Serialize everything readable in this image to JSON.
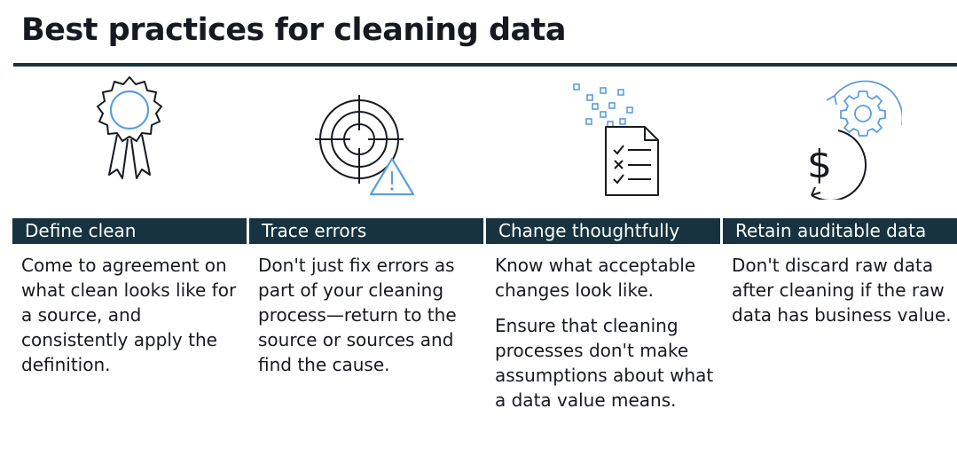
{
  "title": "Best practices for cleaning data",
  "colors": {
    "band": "#16333f",
    "accent": "#5b9ee0",
    "ink": "#16191f"
  },
  "practices": [
    {
      "heading": "Define clean",
      "icon": "award-ribbon-icon",
      "paragraphs": [
        "Come to agreement on what clean looks like for a source, and consistently apply the definition."
      ]
    },
    {
      "heading": "Trace errors",
      "icon": "target-warning-icon",
      "paragraphs": [
        "Don't just fix errors as part of your cleaning process—return to the source or sources and find the cause."
      ]
    },
    {
      "heading": "Change thoughtfully",
      "icon": "checklist-document-icon",
      "paragraphs": [
        "Know what acceptable changes look like.",
        "Ensure that cleaning processes don't make assumptions about what a data value means."
      ]
    },
    {
      "heading": "Retain auditable data",
      "icon": "dollar-gear-cycle-icon",
      "paragraphs": [
        "Don't discard raw data after cleaning if the raw data has business value."
      ]
    }
  ]
}
